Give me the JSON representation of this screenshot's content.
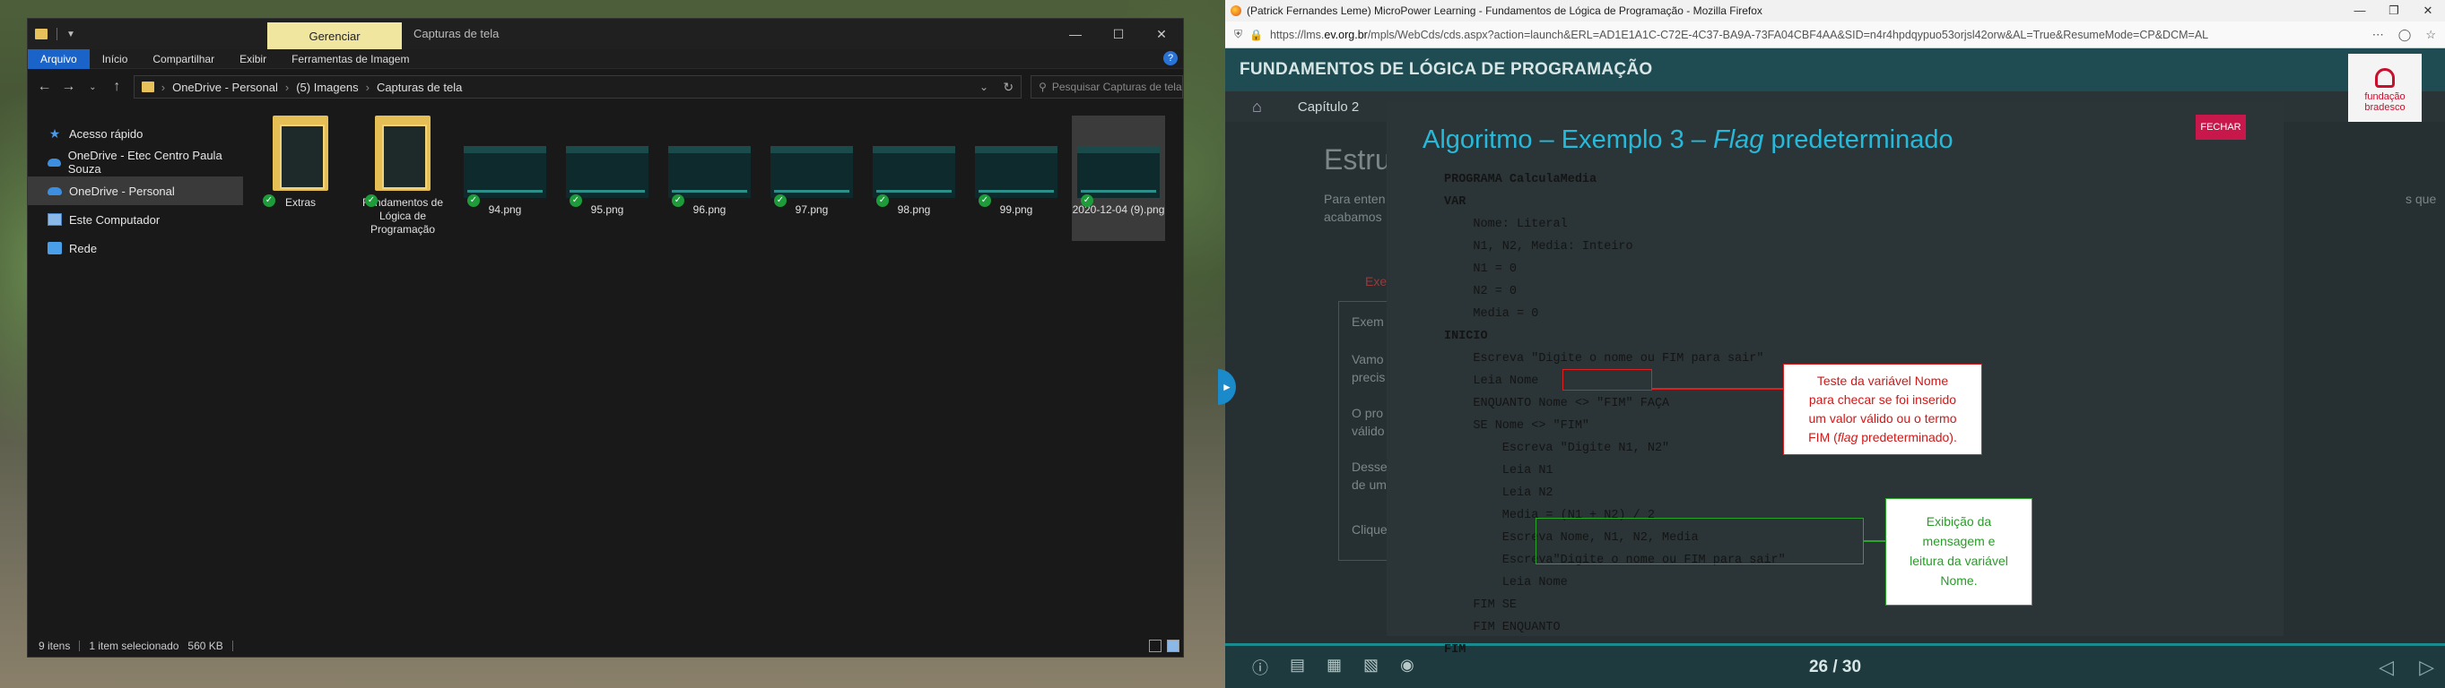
{
  "explorer": {
    "ribbon_context_tab": "Gerenciar",
    "window_title": "Capturas de tela",
    "ribbon_tabs": [
      "Arquivo",
      "Início",
      "Compartilhar",
      "Exibir",
      "Ferramentas de Imagem"
    ],
    "breadcrumb": [
      "OneDrive - Personal",
      "(5) Imagens",
      "Capturas de tela"
    ],
    "search_placeholder": "Pesquisar Capturas de tela",
    "nav": [
      "Acesso rápido",
      "OneDrive - Etec Centro Paula Souza",
      "OneDrive - Personal",
      "Este Computador",
      "Rede"
    ],
    "files": [
      {
        "name": "Extras",
        "kind": "folder"
      },
      {
        "name": "Fundamentos de Lógica de Programação",
        "kind": "folder"
      },
      {
        "name": "94.png",
        "kind": "image"
      },
      {
        "name": "95.png",
        "kind": "image"
      },
      {
        "name": "96.png",
        "kind": "image"
      },
      {
        "name": "97.png",
        "kind": "image"
      },
      {
        "name": "98.png",
        "kind": "image"
      },
      {
        "name": "99.png",
        "kind": "image"
      },
      {
        "name": "2020-12-04 (9).png",
        "kind": "image-selected"
      }
    ],
    "status": {
      "count": "9 itens",
      "selection": "1 item selecionado",
      "size": "560 KB"
    }
  },
  "firefox": {
    "window_title": "(Patrick Fernandes Leme) MicroPower Learning - Fundamentos de Lógica de Programação - Mozilla Firefox",
    "url_prefix": "https://lms.",
    "url_domain": "ev.org.br",
    "url_rest": "/mpls/WebCds/cds.aspx?action=launch&ERL=AD1E1A1C-C72E-4C37-BA9A-73FA04CBF4AA&SID=n4r4hpdqypuo53orjsl42orw&AL=True&ResumeMode=CP&DCM=AL"
  },
  "lms": {
    "course_title": "FUNDAMENTOS DE LÓGICA DE PROGRAMAÇÃO",
    "chapter_label": "Capítulo 2",
    "logo_text_1": "fundação",
    "logo_text_2": "bradesco",
    "page_counter": "26 / 30",
    "bg_heading": "Estru",
    "bg_para_1": "Para enten",
    "bg_para_2": "acabamos",
    "bg_para_right": "s que",
    "bg_tab": "Exe",
    "bg_box_title": "Exem",
    "bg_box_1": "Vamo",
    "bg_box_2": "precis",
    "bg_box_3": "O pro",
    "bg_box_4": "válido",
    "bg_box_5": "Desse",
    "bg_box_6": "de um",
    "bg_box_7": "Clique"
  },
  "modal": {
    "title_prefix": "Algoritmo – Exemplo 3 – ",
    "title_em": "Flag",
    "title_suffix": " predeterminado",
    "close_label": "FECHAR",
    "code_lines": [
      "PROGRAMA CalculaMedia",
      "VAR",
      "    Nome: Literal",
      "    N1, N2, Media: Inteiro",
      "    N1 = 0",
      "    N2 = 0",
      "    Media = 0",
      "INICIO",
      "    Escreva \"Digite o nome ou FIM para sair\"",
      "    Leia Nome",
      "    ENQUANTO Nome <> \"FIM\" FAÇA",
      "    SE Nome <> \"FIM\"",
      "        Escreva \"Digite N1, N2\"",
      "        Leia N1",
      "        Leia N2",
      "        Media = (N1 + N2) / 2",
      "        Escreva Nome, N1, N2, Media",
      "        Escreva\"Digite o nome ou FIM para sair\"",
      "        Leia Nome",
      "    FIM SE",
      "    FIM ENQUANTO",
      "FIM"
    ],
    "callout_red": [
      "Teste da variável Nome",
      "para checar se foi inserido",
      "um valor válido ou o termo",
      "FIM (",
      "flag",
      " predeterminado)."
    ],
    "callout_green": [
      "Exibição da",
      "mensagem e",
      "leitura da variável",
      "Nome."
    ]
  }
}
